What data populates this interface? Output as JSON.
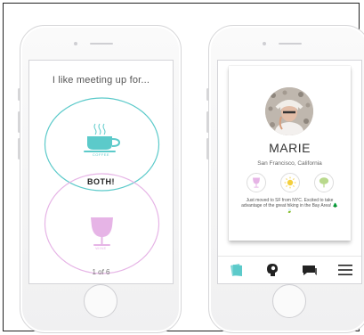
{
  "left_phone": {
    "prompt": "I like meeting up for...",
    "coffee_label": "COFFEE",
    "both_label": "BOTH!",
    "wine_label": "WINE",
    "pager": "1 of 6"
  },
  "right_phone": {
    "profile": {
      "name": "MARIE",
      "location": "San Francisco, California",
      "bio": "Just moved to SF from NYC. Excited to take advantage of the great hiking in the Bay Area! 🌲🍃",
      "preferences": [
        "wine-glass-icon",
        "sun-icon",
        "tree-icon"
      ]
    },
    "tabs": [
      "card-stack-icon",
      "profile-head-icon",
      "chat-icon",
      "menu-icon"
    ]
  },
  "colors": {
    "coffee": "#5ccaca",
    "wine": "#e6b4e6",
    "outline": "#d6d6d8",
    "accent_active_tab": "#5ccaca"
  }
}
